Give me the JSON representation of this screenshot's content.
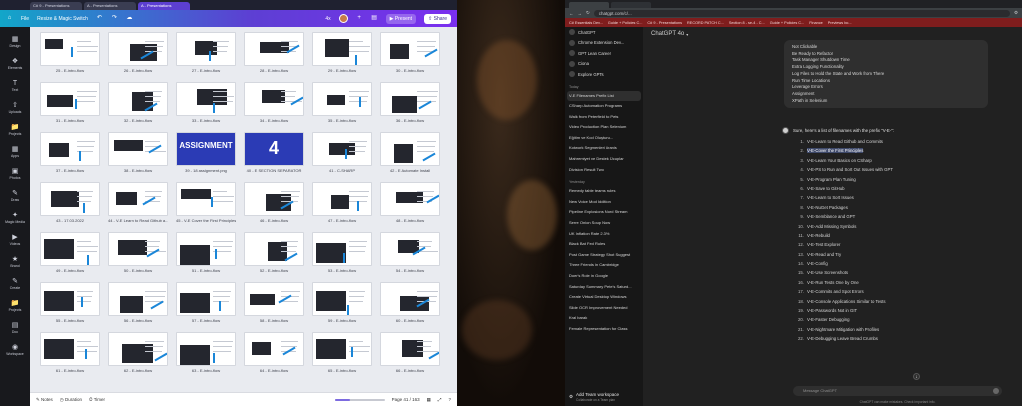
{
  "canva": {
    "tabs": [
      "C# 9 - Presentations",
      "A - Presentations",
      "A - Presentations"
    ],
    "menu": {
      "file": "File",
      "resize": "Resize & Magic Switch"
    },
    "zoom_badge": "4x",
    "present_label": "Present",
    "share_label": "Share",
    "sidebar": [
      "Design",
      "Elements",
      "Text",
      "Uploads",
      "Projects",
      "Apps",
      "Photos",
      "Draw",
      "Magic Media",
      "Videos",
      "Brand",
      "Create",
      "Projects",
      "Doc",
      "Workspace"
    ],
    "pages": [
      "25 - E-intro-flow",
      "26 - E-intro-flow",
      "27 - E-intro-flow",
      "28 - E-intro-flow",
      "29 - E-intro-flow",
      "30 - E-intro-flow",
      "31 - E-intro-flow",
      "32 - E-intro-flow",
      "33 - E-intro-flow",
      "34 - E-intro-flow",
      "35 - E-intro-flow",
      "36 - E-intro-flow",
      "37 - E-intro-flow",
      "38 - E-intro-flow",
      "39 - 18 assignment.png",
      "40 - E SECTION SEPARATOR",
      "41 - C-SHARP",
      "42 - E Automate Install",
      "43 - 17.03.2022",
      "44 - V-E Learn to Read Github a...",
      "45 - V-E Cover the First Principles",
      "46 - E-intro-flow",
      "47 - E-intro-flow",
      "48 - E-intro-flow",
      "49 - E-intro-flow",
      "50 - E-intro-flow",
      "51 - E-intro-flow",
      "52 - E-intro-flow",
      "53 - E-intro-flow",
      "54 - E-intro-flow",
      "55 - E-intro-flow",
      "56 - E-intro-flow",
      "57 - E-intro-flow",
      "58 - E-intro-flow",
      "59 - E-intro-flow",
      "60 - E-intro-flow",
      "61 - E-intro-flow",
      "62 - E-intro-flow",
      "63 - E-intro-flow",
      "64 - E-intro-flow",
      "65 - E-intro-flow",
      "66 - E-intro-flow"
    ],
    "assignment_text": "ASSIGNMENT",
    "separator_num": "4",
    "bottom": {
      "notes": "Notes",
      "duration": "Duration",
      "timer": "Timer",
      "page_counter": "Page 41 / 163",
      "zoom_level": 0.3
    }
  },
  "chrome": {
    "url": "chatgpt.com/c/...",
    "bookmarks": [
      "C# Essentials Dev...",
      "Guide + Policies C...",
      "C# 9 - Presentations",
      "RECORD PATCH C...",
      "Section 8 - se-4 - C...",
      "Guide + Policies C...",
      "Finance",
      "Previews bo..."
    ]
  },
  "chatgpt": {
    "model": "ChatGPT 4o",
    "nav": [
      "ChatGPT",
      "Chrome Extension Dev...",
      "GPT Lean Career",
      "Ciona",
      "Explore GPTs"
    ],
    "today_label": "Today",
    "today": [
      "V-E Filenames Prefix List",
      "CSharp Automation Programs",
      "Walk from Peterfield to Pets",
      "Video Production Plan Selenium",
      "Eğitim ve Kod Oluşturu...",
      "Kotwork Segmenleri üranis",
      "Mahremiyet ve Destek Ücuplar",
      "Division Result Two"
    ],
    "yesterday_label": "Yesterday",
    "yesterday": [
      "Remedy table teams rules",
      "New Voice Mod Iddition",
      "Pipeline Explosions Nord Stream",
      "Serre Onion Soup Now",
      "UK Inflation Rate 2.3%",
      "Black Bat Fed Rules",
      "Post Game Strategy Shot Suggest",
      "Three Friends in Cambridge",
      "Doer's Role in Google",
      "Saturday Summary Pete's Saturd...",
      "Create Virtual Desktop Windows",
      "Slide OCR Improvement Needed",
      "Kral barak",
      "Female Representation for Class"
    ],
    "team_label": "Add Team workspace",
    "team_sub": "Collaborate on a Team plan",
    "user_msg": [
      "Not Clickable",
      "Be Ready to Refactor",
      "Task Manager Shutdown Time",
      "Extra Logging Functionality",
      "Log Files to Hold the State and Work from There",
      "Run Time Locations",
      "Leverage Errors",
      "Assignment",
      "XPath in Selenium"
    ],
    "reply_lead": "Sure, here's a list of filenames with the prefix \"V-E-\":",
    "reply_items": [
      "V-E-Learn to Read Github and Commits",
      "V-E-Cover the First Principles",
      "V-E-Learn Your Basics on CSharp",
      "V-E-PS to Run and Sort Out Issues with GPT",
      "V-E-Program Plan Tuning",
      "V-E-Save to GitHub",
      "V-E-Learn to Sort Issues",
      "V-E-NuGet Packages",
      "V-E-Semblance and GPT",
      "V-E-Add Missing Symbols",
      "V-E-Rebuild",
      "V-E-Test Explorer",
      "V-E-Read and Try",
      "V-E-Config",
      "V-E-Use Screenshots",
      "V-E-Run Tests One by One",
      "V-E-Commits and Spot Errors",
      "V-E-Console Applications Similar to Tests",
      "V-E-Passwords Not in GIT",
      "V-E-Faster Debugging",
      "V-E-Nightmare Mitigation with Profiles",
      "V-E-Debugging Leave Bread Crumbs"
    ],
    "composer_placeholder": "Message ChatGPT",
    "disclaimer": "ChatGPT can make mistakes. Check important info."
  }
}
